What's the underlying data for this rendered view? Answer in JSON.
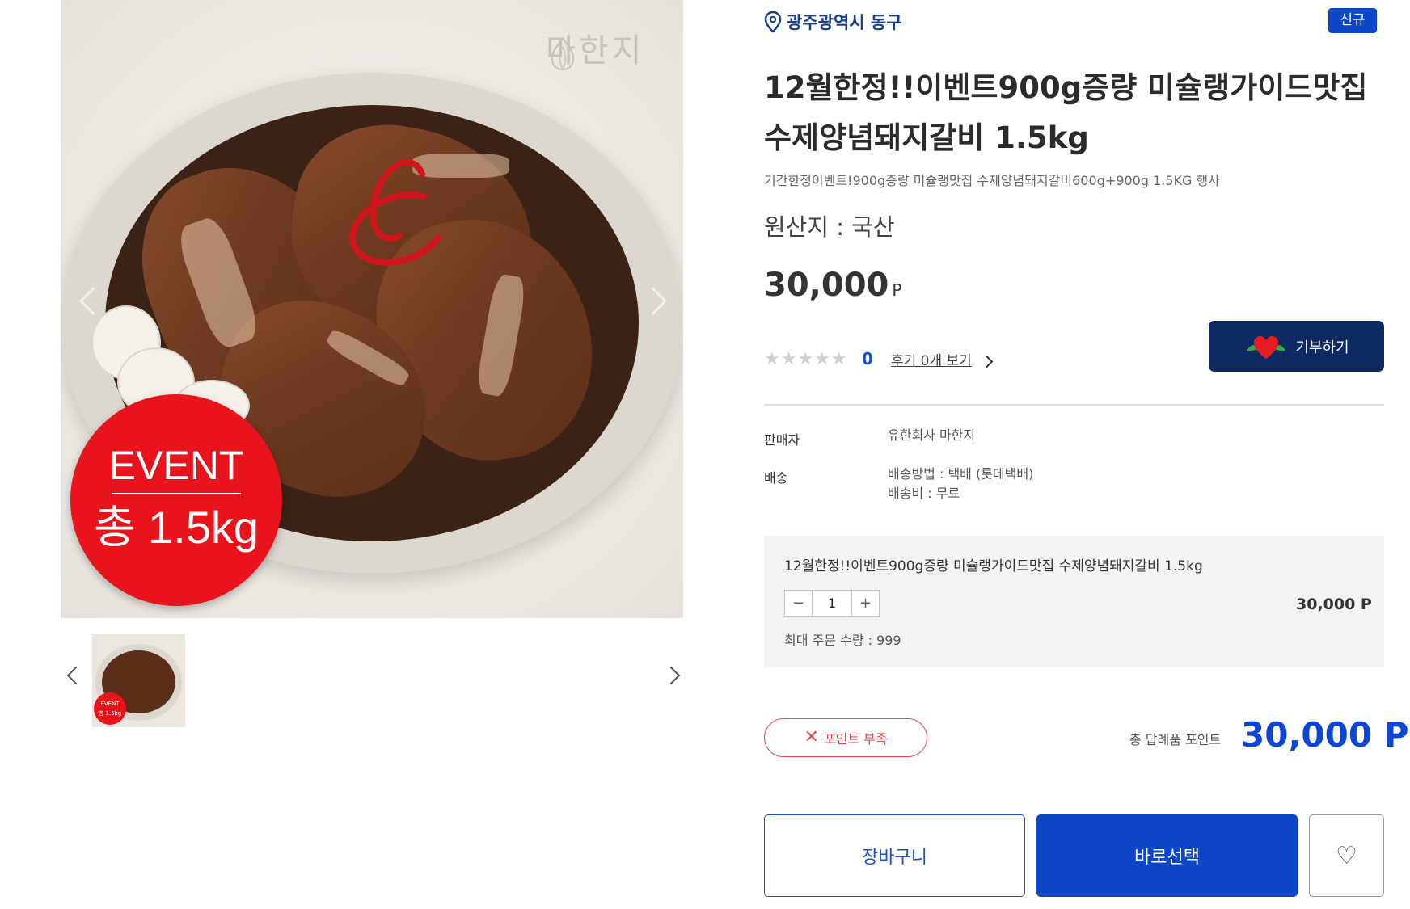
{
  "gallery": {
    "brand_watermark": "마한지",
    "badge": {
      "title": "EVENT",
      "weight": "총 1.5kg"
    },
    "thumbnail_badge": {
      "title": "EVENT",
      "weight": "총 1.5kg"
    }
  },
  "product": {
    "location": "광주광역시 동구",
    "new_badge": "신규",
    "title_line1": "12월한정!!이벤트900g증량 미슐랭가이드맛집",
    "title_line2": "수제양념돼지갈비 1.5kg",
    "subtitle": "기간한정이벤트!900g증량 미슐랭맛집 수제양념돼지갈비600g+900g 1.5KG 행사",
    "origin": "원산지 : 국산",
    "price": "30,000",
    "price_unit": "P",
    "rating_stars": "★★★★★",
    "rating_value": 0,
    "rating_count": "0",
    "review_link": "후기 0개 보기",
    "donate_label": "기부하기",
    "seller_label": "판매자",
    "seller_value": "유한회사 마한지",
    "shipping_label": "배송",
    "shipping_method": "배송방법 : 택배 (롯데택배)",
    "shipping_fee": "배송비 : 무료"
  },
  "option": {
    "title": "12월한정!!이벤트900g증량 미슐랭가이드맛집 수제양념돼지갈비 1.5kg",
    "minus": "−",
    "qty": "1",
    "plus": "+",
    "price": "30,000 P",
    "max_order": "최대 주문 수량 : 999"
  },
  "summary": {
    "shortage_label": "포인트 부족",
    "total_label": "총 답례품 포인트",
    "total_value": "30,000 P"
  },
  "actions": {
    "cart": "장바구니",
    "buy": "바로선택",
    "wish_icon": "♡"
  },
  "colors": {
    "primary": "#0d47c7",
    "navy": "#0e2a63",
    "event_red": "#e8131b",
    "warning_red": "#e24a4a"
  }
}
